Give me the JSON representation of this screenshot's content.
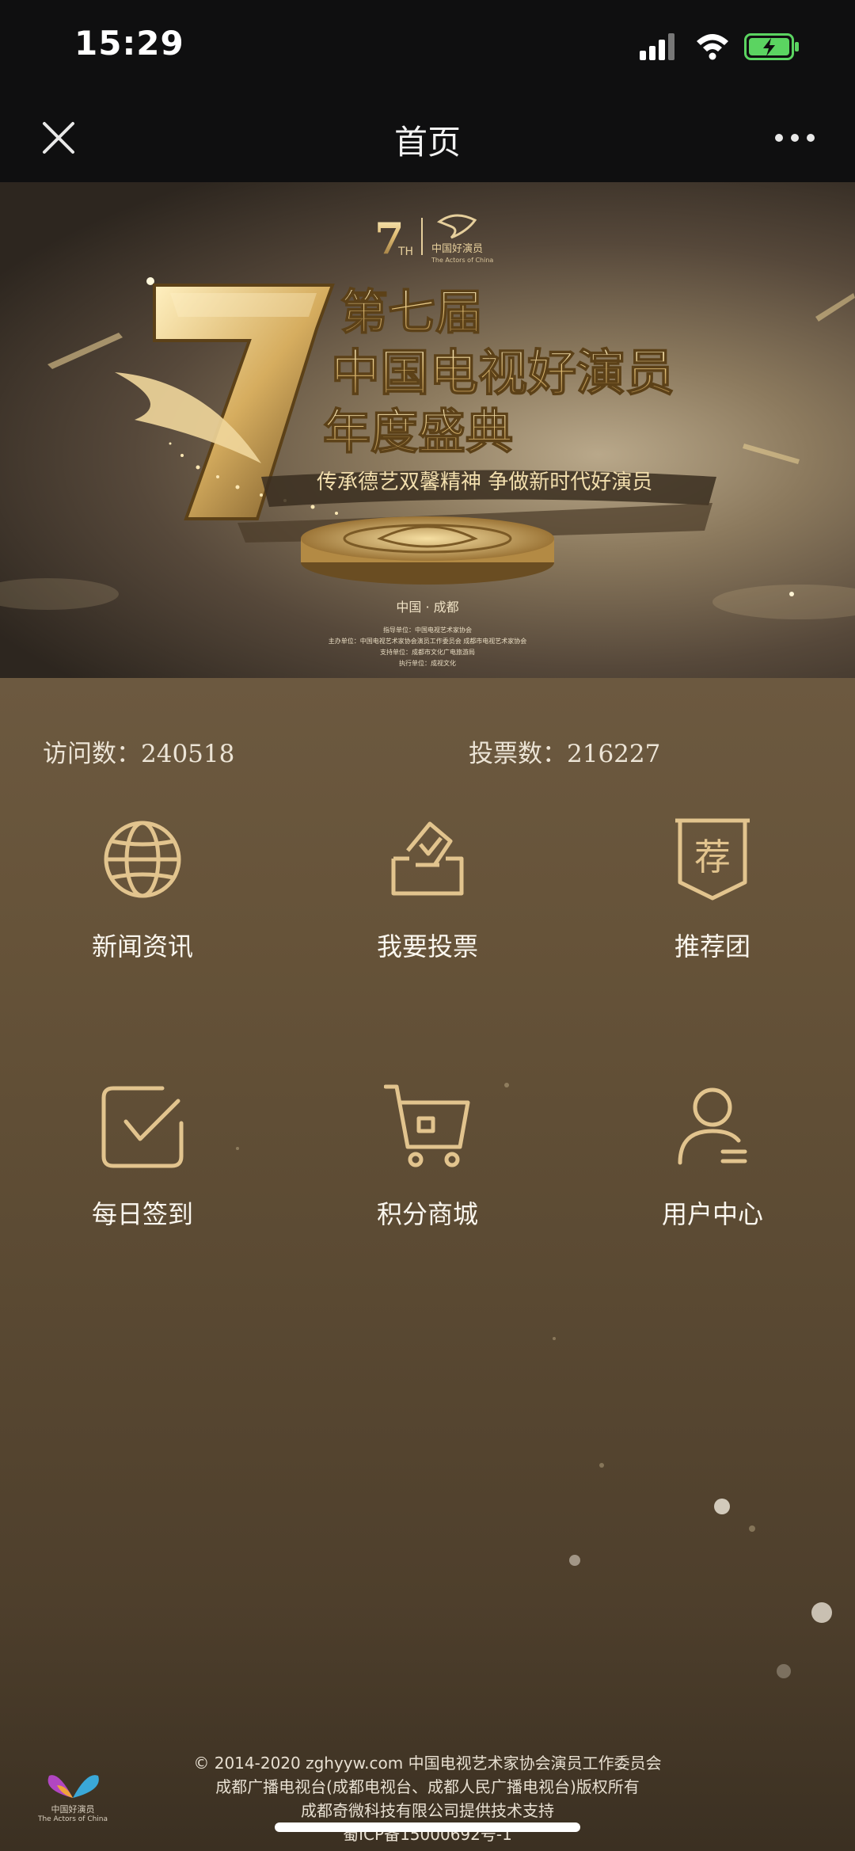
{
  "status_bar": {
    "time": "15:29"
  },
  "nav": {
    "title": "首页"
  },
  "banner": {
    "badge_number": "7",
    "badge_suffix": "TH",
    "logo_cn": "中国好演员",
    "logo_en": "The Actors of China",
    "title_line1": "第七届",
    "title_line2": "中国电视好演员",
    "title_line3": "年度盛典",
    "slogan": "传承德艺双馨精神 争做新时代好演员",
    "location": "中国 · 成都",
    "credits": [
      "指导单位：中国电视艺术家协会",
      "主办单位：中国电视艺术家协会演员工作委员会 成都市电视艺术家协会",
      "支持单位：成都市文化广电旅游局",
      "执行单位：成视文化"
    ]
  },
  "stats": {
    "visits_label": "访问数：",
    "visits_value": "240518",
    "votes_label": "投票数：",
    "votes_value": "216227"
  },
  "menu": [
    {
      "label": "新闻资讯",
      "icon": "globe-icon"
    },
    {
      "label": "我要投票",
      "icon": "ballot-box-icon"
    },
    {
      "label": "推荐团",
      "icon": "recommend-badge-icon",
      "glyph": "荐"
    },
    {
      "label": "每日签到",
      "icon": "checkbox-icon"
    },
    {
      "label": "积分商城",
      "icon": "shopping-cart-icon"
    },
    {
      "label": "用户中心",
      "icon": "user-icon"
    }
  ],
  "footer": {
    "line1": "© 2014-2020 zghyyw.com 中国电视艺术家协会演员工作委员会",
    "line2": "成都广播电视台(成都电视台、成都人民广播电视台)版权所有",
    "line3": "成都奇微科技有限公司提供技术支持",
    "line4": "蜀ICP备15000692号-1",
    "logo_cn": "中国好演员",
    "logo_en": "The Actors of China"
  },
  "colors": {
    "gold": "#e2c48e",
    "gold_dark": "#b08a4f",
    "background": "#5b4a33",
    "bar": "#0f0f10",
    "battery": "#5bd461"
  }
}
